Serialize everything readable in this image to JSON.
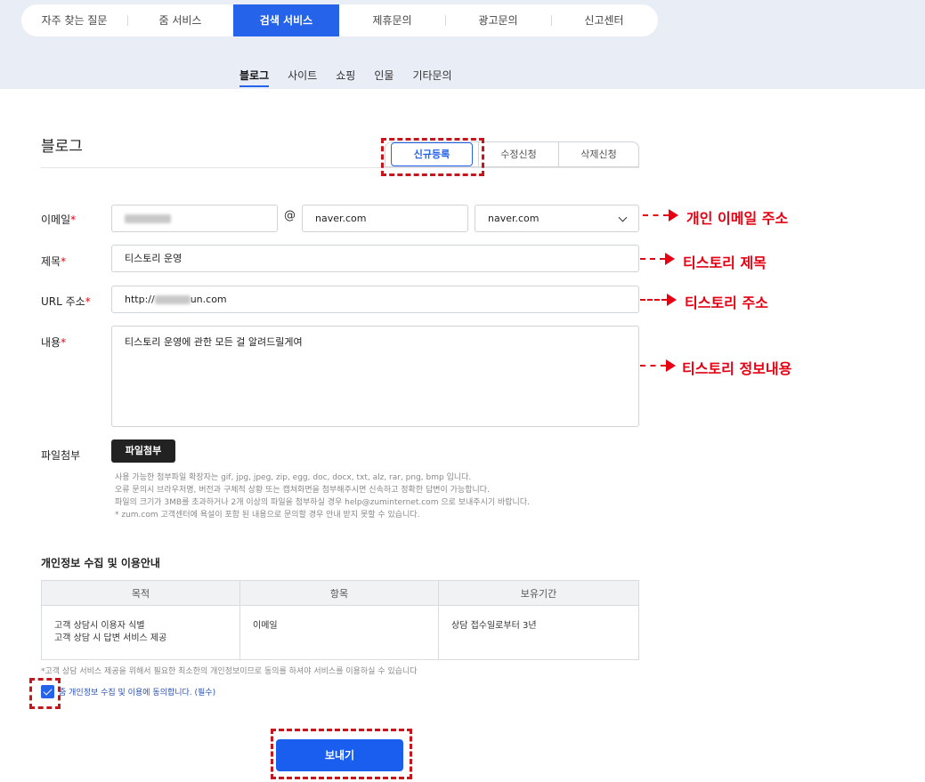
{
  "main_tabs": [
    "자주 찾는 질문",
    "줌 서비스",
    "검색 서비스",
    "제휴문의",
    "광고문의",
    "신고센터"
  ],
  "sub_tabs": [
    "블로그",
    "사이트",
    "쇼핑",
    "인물",
    "기타문의"
  ],
  "section_title": "블로그",
  "segments": [
    "신규등록",
    "수정신청",
    "삭제신청"
  ],
  "form": {
    "email_label": "이메일",
    "title_label": "제목",
    "url_label": "URL 주소",
    "content_label": "내용",
    "file_label": "파일첨부",
    "required_mark": "*",
    "email_at": "@",
    "email_domain": "naver.com",
    "email_domain_select": "naver.com",
    "title_value": "티스토리 운영",
    "url_prefix": "http://",
    "url_suffix": "un.com",
    "content_value": "티스토리 운영에 관한 모든 걸 알려드릴게여",
    "file_button": "파일첨부",
    "help_lines": [
      "사용 가능한 첨부파일 확장자는 gif, jpg, jpeg, zip, egg, doc, docx, txt, alz, rar, png, bmp 입니다.",
      "오류 문의시 브라우저명, 버전과 구체적 상황 또는 캡쳐화면을 첨부해주시면 신속하고 정확한 답변이 가능합니다.",
      "파일의 크기가 3MB를 초과하거나 2개 이상의 파일을 첨부하실 경우 help@zuminternet.com 으로 보내주시기 바랍니다.",
      "* zum.com 고객센터에 욕설이 포함 된 내용으로 문의할 경우 안내 받지 못할 수 있습니다."
    ]
  },
  "annotations": {
    "email": "개인 이메일 주소",
    "title": "티스토리 제목",
    "url": "티스토리 주소",
    "content": "티스토리 정보내용"
  },
  "privacy": {
    "title": "개인정보 수집 및 이용안내",
    "headers": [
      "목적",
      "항목",
      "보유기간"
    ],
    "purpose_lines": [
      "고객 상담시 이용자 식별",
      "고객 상담 시 답변 서비스 제공"
    ],
    "item": "이메일",
    "period": "상담 접수일로부터 3년",
    "notice": "*고객 상담 서비스 제공을 위해서 필요한 최소한의 개인정보이므로 동의를 하셔야 서비스를 이용하실 수 있습니다",
    "agree_text": "줌 개인정보 수집 및 이용에 동의합니다. (필수)"
  },
  "send_button": "보내기",
  "colors": {
    "accent": "#2563eb",
    "annotation": "#e60012"
  }
}
